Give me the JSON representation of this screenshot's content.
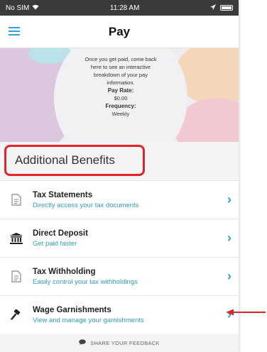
{
  "status_bar": {
    "carrier": "No SIM",
    "time": "11:28 AM"
  },
  "nav": {
    "title": "Pay",
    "menu_icon": "hamburger-menu-icon"
  },
  "hero": {
    "line1": "Once you get paid, come back",
    "line2": "here to see an interactive",
    "line3": "breakdown of your pay",
    "line4": "information.",
    "pay_rate_label": "Pay Rate:",
    "pay_rate_value": "$0.00",
    "frequency_label": "Frequency:",
    "frequency_value": "Weekly"
  },
  "section": {
    "title": "Additional Benefits"
  },
  "items": [
    {
      "title": "Tax Statements",
      "subtitle": "Directly access your tax documents",
      "icon": "document-icon"
    },
    {
      "title": "Direct Deposit",
      "subtitle": "Get paid faster",
      "icon": "bank-icon"
    },
    {
      "title": "Tax Withholding",
      "subtitle": "Easily control your tax withholdings",
      "icon": "document-icon"
    },
    {
      "title": "Wage Garnishments",
      "subtitle": "View and manage your garnishments",
      "icon": "gavel-icon"
    }
  ],
  "footer": {
    "label": "SHARE YOUR FEEDBACK"
  },
  "colors": {
    "accent": "#2aa7d6",
    "highlight": "#e0242a",
    "subtitle": "#2e9fb0"
  }
}
